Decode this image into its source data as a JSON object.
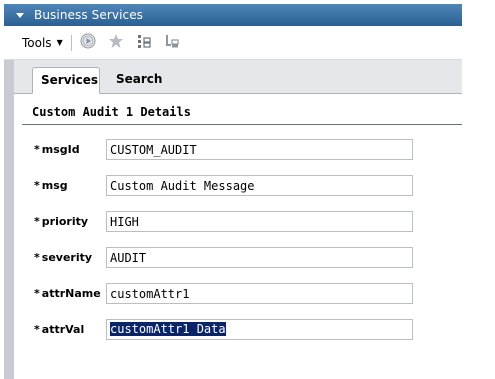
{
  "window": {
    "title": "Business Services"
  },
  "toolbar": {
    "tools_label": "Tools",
    "icons": [
      "play-icon",
      "star-icon",
      "tree-add-icon",
      "tree-remove-icon"
    ]
  },
  "tabs": [
    {
      "label": "Services",
      "active": true
    },
    {
      "label": "Search",
      "active": false
    }
  ],
  "section": {
    "title": "Custom Audit 1 Details"
  },
  "fields": [
    {
      "label": "msgId",
      "value": "CUSTOM_AUDIT",
      "required": true
    },
    {
      "label": "msg",
      "value": "Custom Audit Message",
      "required": true
    },
    {
      "label": "priority",
      "value": "HIGH",
      "required": true
    },
    {
      "label": "severity",
      "value": "AUDIT",
      "required": true
    },
    {
      "label": "attrName",
      "value": "customAttr1",
      "required": true
    },
    {
      "label": "attrVal",
      "value": "customAttr1 Data",
      "required": true,
      "selected": true
    }
  ],
  "required_marker": "*",
  "colors": {
    "titlebar": "#3a6fa3",
    "selection": "#0a246a"
  }
}
